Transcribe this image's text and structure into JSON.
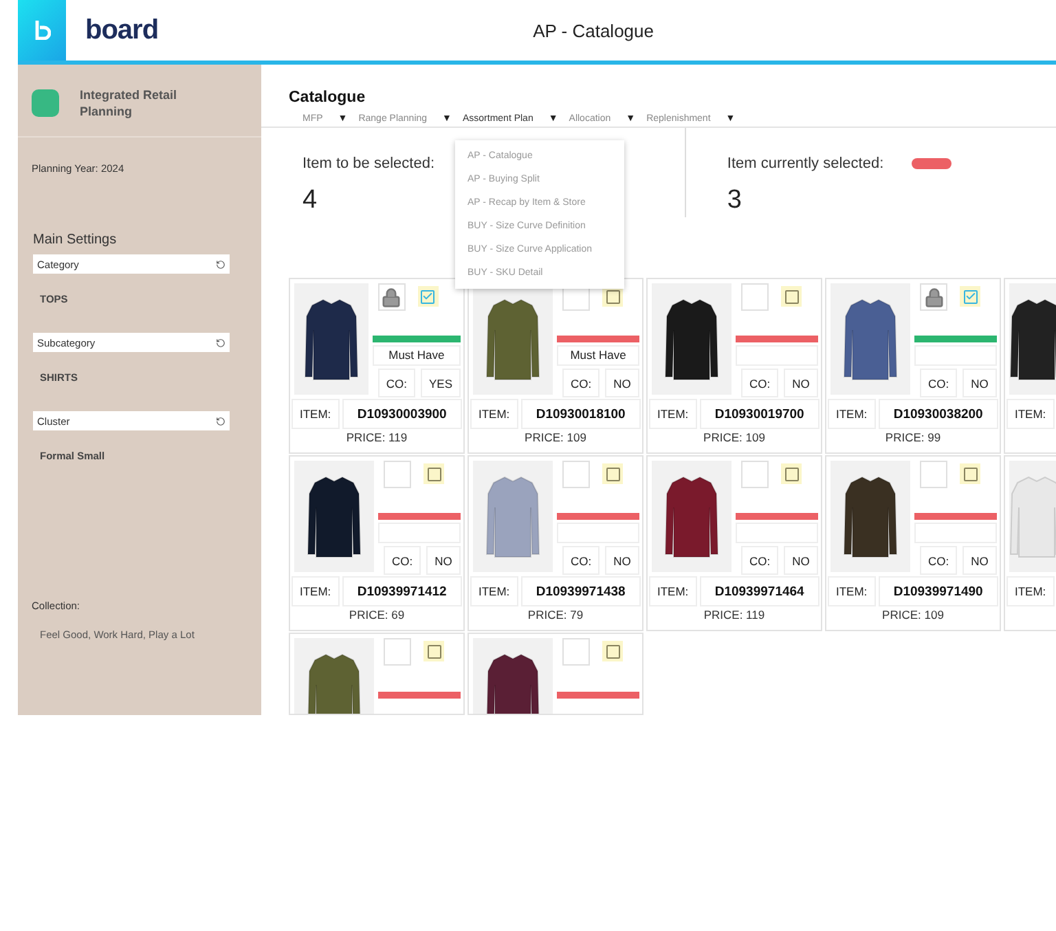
{
  "header": {
    "logo": "board",
    "title": "AP - Catalogue"
  },
  "sidebar": {
    "app_name": "Integrated Retail Planning",
    "planning_year": "Planning Year: 2024",
    "section_title": "Main Settings",
    "filters": [
      {
        "label": "Category",
        "value": "TOPS"
      },
      {
        "label": "Subcategory",
        "value": "SHIRTS"
      },
      {
        "label": "Cluster",
        "value": "Formal Small"
      }
    ],
    "collection_label": "Collection:",
    "collection_value": "Feel Good, Work Hard, Play a Lot"
  },
  "page": {
    "title": "Catalogue",
    "nav": [
      {
        "label": "MFP",
        "selected": false
      },
      {
        "label": "Range Planning",
        "selected": false
      },
      {
        "label": "Assortment Plan",
        "selected": true
      },
      {
        "label": "Allocation",
        "selected": false
      },
      {
        "label": "Replenishment",
        "selected": false
      }
    ],
    "nav_arrow": "▼",
    "menu": [
      "AP - Catalogue",
      "AP - Buying Split",
      "AP - Recap by Item & Store",
      "BUY - Size Curve Definition",
      "BUY - Size Curve Application",
      "BUY - SKU Detail"
    ],
    "summary": [
      {
        "label": "Item to be selected:",
        "value": "4"
      },
      {
        "label": "Item currently selected:",
        "value": "3"
      }
    ]
  },
  "products": [
    {
      "kind": "full",
      "color": "#1e2a4a",
      "locked": true,
      "checked": true,
      "bar": {
        "color": "#2cb670"
      },
      "tag": "Must Have",
      "co_label": "CO:",
      "co_value": "YES",
      "item_label": "ITEM:",
      "item": "D10930003900",
      "price": "PRICE: 119"
    },
    {
      "kind": "full",
      "color": "#5e6233",
      "locked": false,
      "checked": false,
      "bar": {
        "color": "#ec6065"
      },
      "tag": "Must Have",
      "co_label": "CO:",
      "co_value": "NO",
      "item_label": "ITEM:",
      "item": "D10930018100",
      "price": "PRICE: 109"
    },
    {
      "kind": "full",
      "color": "#1a1a1a",
      "locked": false,
      "checked": false,
      "bar": {
        "color": "#ec6065"
      },
      "co_label": "CO:",
      "co_value": "NO",
      "item_label": "ITEM:",
      "item": "D10930019700",
      "price": "PRICE: 109"
    },
    {
      "kind": "full",
      "color": "#4a5f94",
      "locked": true,
      "checked": true,
      "bar": {
        "color": "#2cb670"
      },
      "co_label": "CO:",
      "co_value": "NO",
      "item_label": "ITEM:",
      "item": "D10930038200",
      "price": "PRICE: 99"
    },
    {
      "kind": "edge",
      "color": "#222222",
      "item_label": "ITEM:"
    },
    {
      "kind": "full",
      "color": "#111a2b",
      "locked": false,
      "checked": false,
      "bar": {
        "color": "#ec6065"
      },
      "co_label": "CO:",
      "co_value": "NO",
      "item_label": "ITEM:",
      "item": "D10939971412",
      "price": "PRICE: 69"
    },
    {
      "kind": "full",
      "color": "#9aa3bd",
      "locked": false,
      "checked": false,
      "bar": {
        "color": "#ec6065"
      },
      "co_label": "CO:",
      "co_value": "NO",
      "item_label": "ITEM:",
      "item": "D10939971438",
      "price": "PRICE: 79"
    },
    {
      "kind": "full",
      "color": "#7a1a2c",
      "locked": false,
      "checked": false,
      "bar": {
        "color": "#ec6065"
      },
      "co_label": "CO:",
      "co_value": "NO",
      "item_label": "ITEM:",
      "item": "D10939971464",
      "price": "PRICE: 119"
    },
    {
      "kind": "full",
      "color": "#3a3022",
      "locked": false,
      "checked": false,
      "bar": {
        "color": "#ec6065"
      },
      "co_label": "CO:",
      "co_value": "NO",
      "item_label": "ITEM:",
      "item": "D10939971490",
      "price": "PRICE: 109"
    },
    {
      "kind": "edge",
      "color": "#e8e8e8",
      "item_label": "ITEM:"
    },
    {
      "kind": "top",
      "color": "#5e6233",
      "locked": false,
      "checked": false,
      "bar": {
        "color": "#ec6065"
      }
    },
    {
      "kind": "top",
      "color": "#5a1f35",
      "locked": false,
      "checked": false,
      "bar": {
        "color": "#ec6065"
      }
    }
  ]
}
